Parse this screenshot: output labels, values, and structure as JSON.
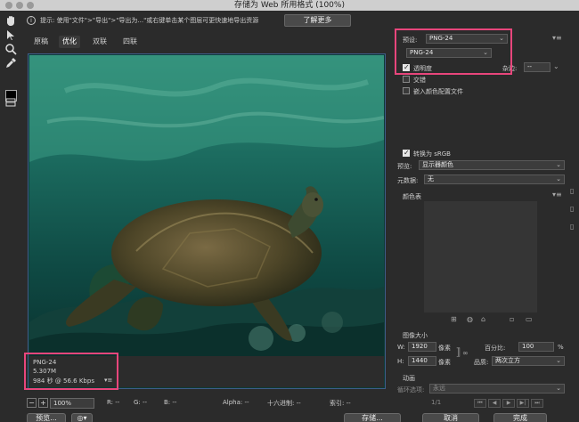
{
  "window": {
    "title": "存储为 Web 所用格式 (100%)"
  },
  "tip": {
    "icon": "info-icon",
    "text": "提示: 使用\"文件\">\"导出\">\"导出为...\"或右键单击某个图层可更快速地导出资源",
    "button": "了解更多"
  },
  "tabs": [
    "原稿",
    "优化",
    "双联",
    "四联"
  ],
  "image_info": {
    "format": "PNG-24",
    "size": "5.307M",
    "time": "984 秒 @ 56.6 Kbps"
  },
  "status": {
    "zoom": "100%",
    "r": "R: --",
    "g": "G: --",
    "b": "B: --",
    "alpha": "Alpha: --",
    "hex": "十六进制: --",
    "index": "索引: --"
  },
  "panel": {
    "preset_label": "预设:",
    "preset_value": "PNG-24",
    "format_value": "PNG-24",
    "transparency_label": "透明度",
    "matte_label": "杂边:",
    "matte_value": "--",
    "interlaced_label": "交错",
    "embed_profile_label": "嵌入颜色配置文件",
    "convert_srgb_label": "转换为 sRGB",
    "preview_label": "预览:",
    "preview_value": "显示器颜色",
    "metadata_label": "元数据:",
    "metadata_value": "无",
    "color_table_label": "颜色表",
    "image_size_label": "图像大小",
    "w_label": "W:",
    "w_value": "1920",
    "h_label": "H:",
    "h_value": "1440",
    "px_unit": "像素",
    "percent_label": "百分比:",
    "percent_value": "100",
    "percent_unit": "%",
    "quality_label": "品质:",
    "quality_value": "两次立方",
    "animation_label": "动画",
    "loop_label": "循环选项:",
    "loop_value": "永远",
    "frame_counter": "1/1"
  },
  "bottom": {
    "preview_button": "预览...",
    "save_button": "存储...",
    "cancel_button": "取消",
    "done_button": "完成"
  },
  "colors": {
    "highlight": "#e8467c",
    "canvas_border": "#3f5d8a"
  }
}
